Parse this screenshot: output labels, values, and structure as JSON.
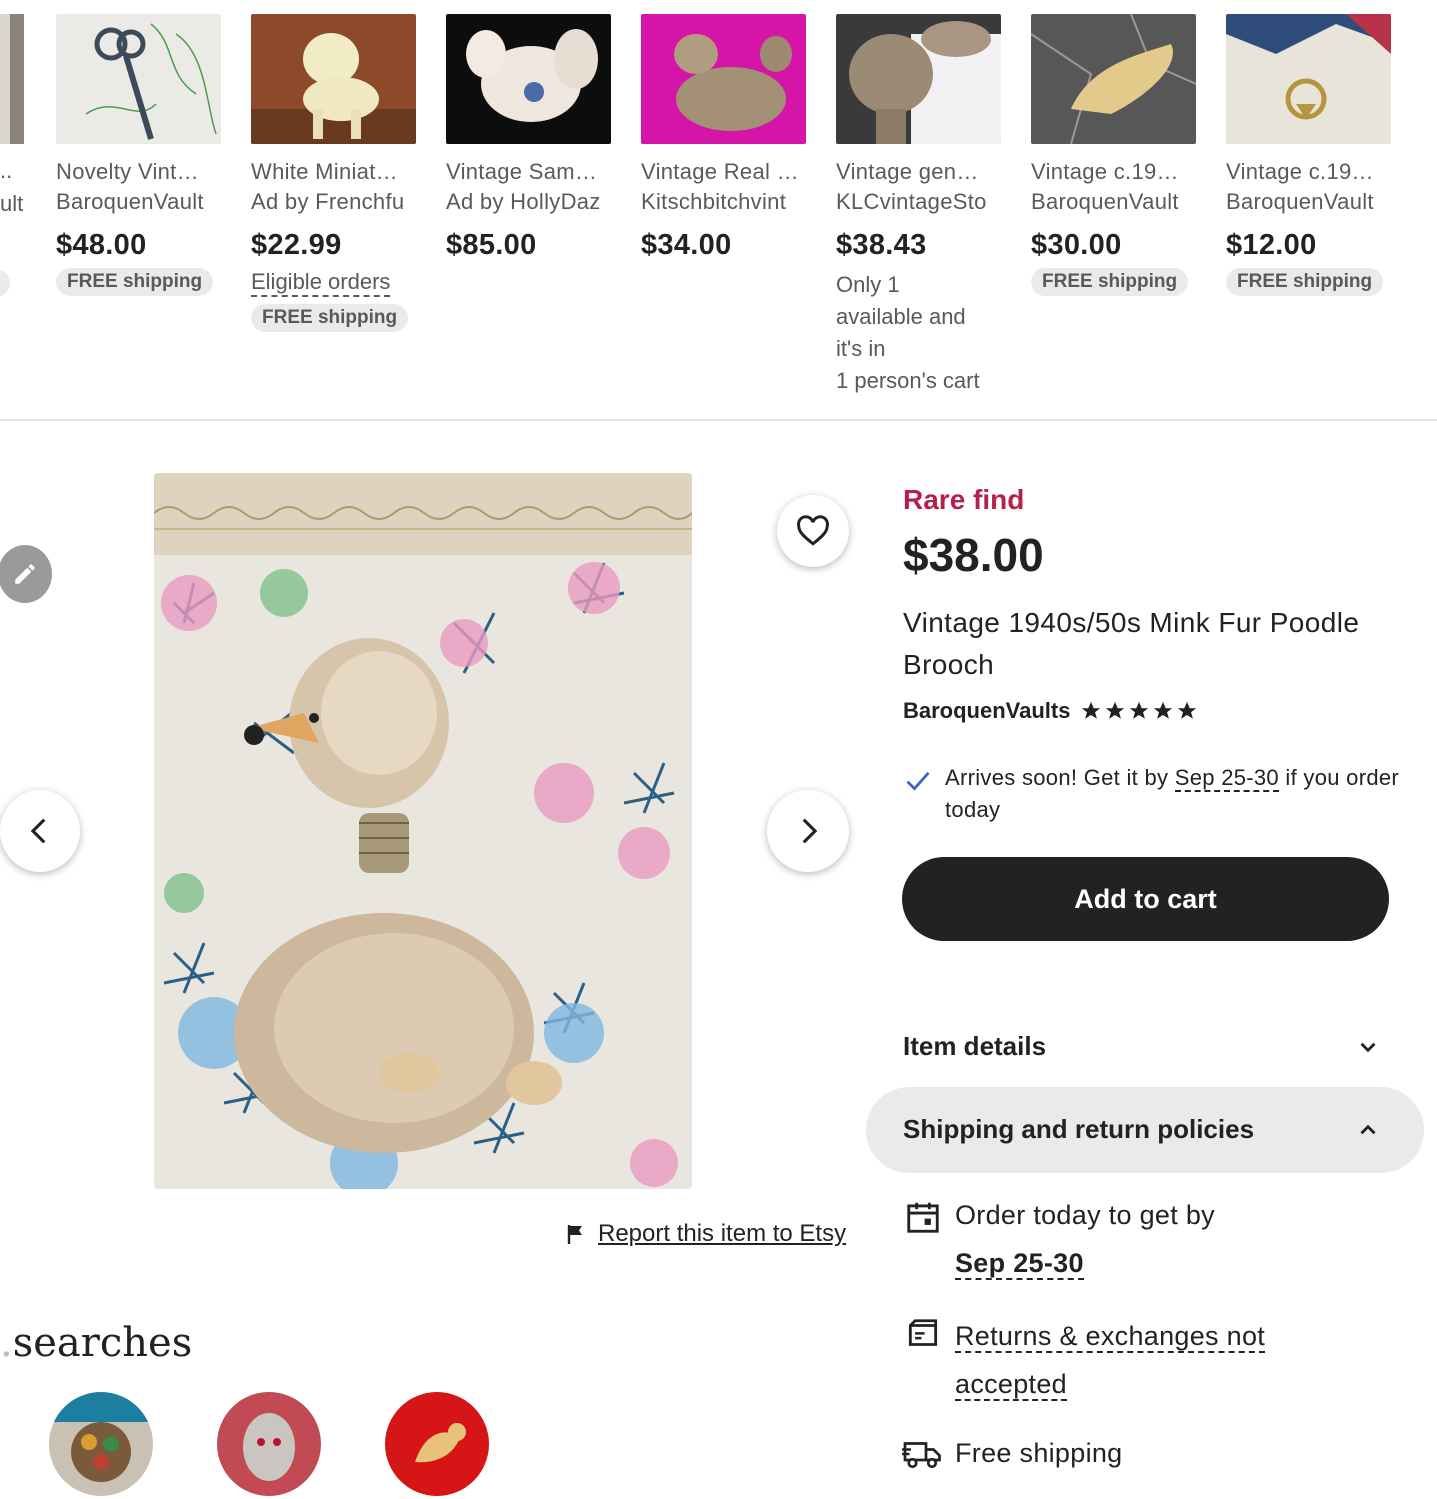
{
  "recommendations": [
    {
      "title": "Novelty Vint…",
      "shop": "BaroquenVault",
      "price": "$48.00",
      "badge": "FREE shipping"
    },
    {
      "title": "White Miniat…",
      "shop": "Ad by Frenchfu",
      "price": "$22.99",
      "eligible": "Eligible orders",
      "badge": "FREE shipping"
    },
    {
      "title": "Vintage Sam…",
      "shop": "Ad by HollyDaz",
      "price": "$85.00"
    },
    {
      "title": "Vintage Real …",
      "shop": "Kitschbitchvint",
      "price": "$34.00"
    },
    {
      "title": "Vintage gen…",
      "shop": "KLCvintageSto",
      "price": "$38.43",
      "stock_lines": [
        "Only 1",
        "available and",
        "it's in",
        "1 person's cart"
      ]
    },
    {
      "title": "Vintage c.19…",
      "shop": "BaroquenVault",
      "price": "$30.00",
      "badge": "FREE shipping"
    },
    {
      "title": "Vintage c.19…",
      "shop": "BaroquenVault",
      "price": "$12.00",
      "badge": "FREE shipping"
    }
  ],
  "partial_card": {
    "title": "..",
    "shop": "ult"
  },
  "listing": {
    "rare_label": "Rare find",
    "price": "$38.00",
    "title": "Vintage 1940s/50s Mink Fur Poodle Brooch",
    "shop_name": "BaroquenVaults",
    "rating_stars": 5,
    "arrival_prefix": "Arrives soon! Get it by ",
    "arrival_date": "Sep 25-30",
    "arrival_suffix": " if you order today",
    "add_to_cart": "Add to cart",
    "item_details": "Item details",
    "shipping_policies": "Shipping and return policies",
    "order_today": "Order today to get by",
    "order_date": "Sep 25-30",
    "returns_line1": "Returns & exchanges not",
    "returns_line2": "accepted",
    "free_shipping": "Free shipping"
  },
  "report_link": "Report this item to Etsy",
  "searches_heading": "searches",
  "colors": {
    "accent_rare": "#b51f4b",
    "button_dark": "#222222",
    "pill_bg": "#eaeaea"
  }
}
